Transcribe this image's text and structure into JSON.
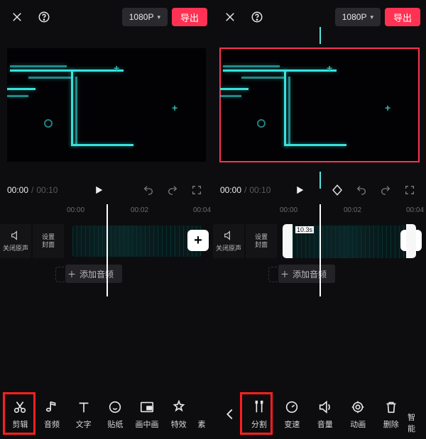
{
  "topbar": {
    "resolution": "1080P",
    "export_label": "导出"
  },
  "transport": {
    "current_time": "00:00",
    "duration": "00:10",
    "separator": "/"
  },
  "ruler": {
    "ticks": [
      "00:00",
      "00:02",
      "00:04"
    ]
  },
  "timeline": {
    "mute_label": "关闭原声",
    "cover_label": "设置\n封面",
    "add_audio_label": "添加音频",
    "clip_duration_label": "10.3s"
  },
  "toolbar_left": [
    {
      "name": "edit",
      "label": "剪辑"
    },
    {
      "name": "audio",
      "label": "音频"
    },
    {
      "name": "text",
      "label": "文字"
    },
    {
      "name": "sticker",
      "label": "贴纸"
    },
    {
      "name": "pip",
      "label": "画中画"
    },
    {
      "name": "effects",
      "label": "特效"
    },
    {
      "name": "stock",
      "label": "素"
    }
  ],
  "toolbar_right": [
    {
      "name": "split",
      "label": "分割"
    },
    {
      "name": "speed",
      "label": "变速"
    },
    {
      "name": "volume",
      "label": "音量"
    },
    {
      "name": "anim",
      "label": "动画"
    },
    {
      "name": "delete",
      "label": "删除"
    },
    {
      "name": "smart",
      "label": "智能"
    }
  ]
}
